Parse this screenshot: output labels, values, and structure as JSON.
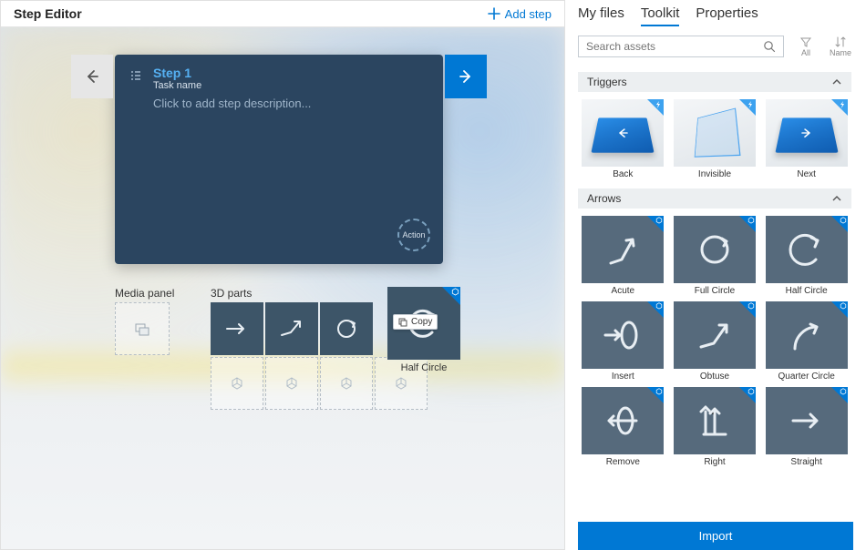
{
  "header": {
    "title": "Step Editor",
    "add_step": "Add step"
  },
  "card": {
    "step_title": "Step 1",
    "task_name": "Task name",
    "description_placeholder": "Click to add step description...",
    "action_label": "Action"
  },
  "media_panel_label": "Media panel",
  "parts_label": "3D parts",
  "drop": {
    "label": "Half Circle",
    "tooltip": "Copy"
  },
  "tabs": {
    "my_files": "My files",
    "toolkit": "Toolkit",
    "properties": "Properties"
  },
  "search": {
    "placeholder": "Search assets"
  },
  "filters": {
    "all": "All",
    "name": "Name"
  },
  "sections": {
    "triggers": {
      "title": "Triggers",
      "items": [
        {
          "label": "Back"
        },
        {
          "label": "Invisible"
        },
        {
          "label": "Next"
        }
      ]
    },
    "arrows": {
      "title": "Arrows",
      "items": [
        {
          "label": "Acute"
        },
        {
          "label": "Full Circle"
        },
        {
          "label": "Half Circle"
        },
        {
          "label": "Insert"
        },
        {
          "label": "Obtuse"
        },
        {
          "label": "Quarter Circle"
        },
        {
          "label": "Remove"
        },
        {
          "label": "Right"
        },
        {
          "label": "Straight"
        }
      ]
    }
  },
  "import_label": "Import"
}
